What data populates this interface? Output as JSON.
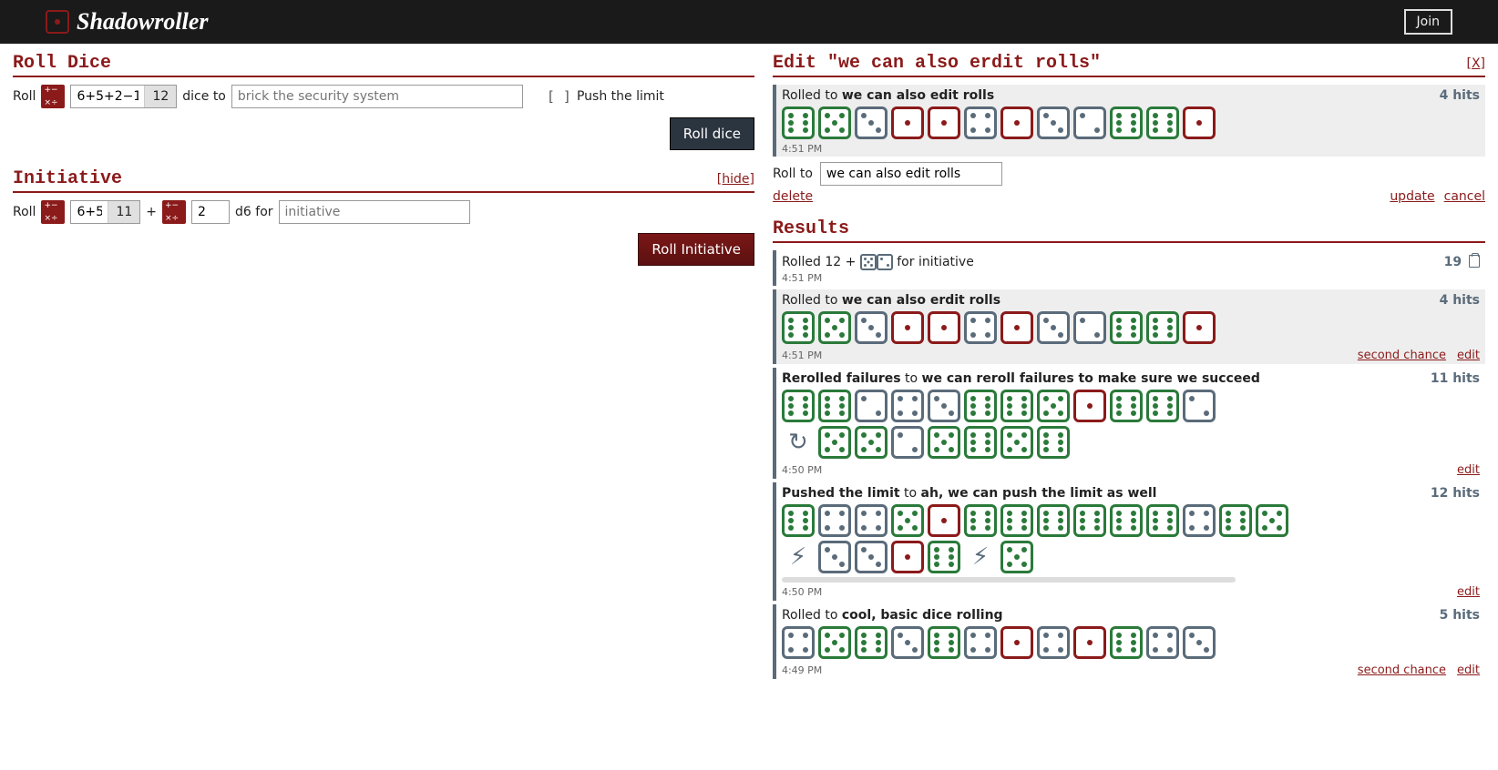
{
  "header": {
    "app_name": "Shadowroller",
    "join_label": "Join"
  },
  "roll_dice": {
    "title": "Roll Dice",
    "roll_label": "Roll",
    "expr_value": "6+5+2−1",
    "expr_result": "12",
    "dice_to_label": "dice to",
    "title_placeholder": "brick the security system",
    "push_limit_label": "Push the limit",
    "button_label": "Roll dice"
  },
  "initiative": {
    "title": "Initiative",
    "hide_label": "[hide]",
    "roll_label": "Roll",
    "base_expr": "6+5",
    "base_result": "11",
    "plus_label": "+",
    "dice_expr": "2",
    "d6_for_label": "d6 for",
    "title_placeholder": "initiative",
    "button_label": "Roll Initiative"
  },
  "edit": {
    "title": "Edit \"we can also erdit rolls\"",
    "close_label": "[X]",
    "card": {
      "prefix": "Rolled to ",
      "title": "we can also edit rolls",
      "hits": "4 hits",
      "time": "4:51 PM",
      "dice": [
        6,
        5,
        3,
        1,
        1,
        4,
        1,
        3,
        2,
        6,
        6,
        1
      ]
    },
    "roll_to_label": "Roll to",
    "roll_to_value": "we can also edit rolls",
    "delete_label": "delete",
    "update_label": "update",
    "cancel_label": "cancel"
  },
  "results": {
    "title": "Results",
    "items": [
      {
        "type": "initiative",
        "prefix": "Rolled 12 + ",
        "dice_inline": [
          5,
          2
        ],
        "suffix": " for initiative",
        "score": "19",
        "time": "4:51 PM"
      },
      {
        "type": "roll",
        "highlight": true,
        "prefix": "Rolled to ",
        "title": "we can also erdit rolls",
        "hits": "4 hits",
        "dice": [
          6,
          5,
          3,
          1,
          1,
          4,
          1,
          3,
          2,
          6,
          6,
          1
        ],
        "time": "4:51 PM",
        "actions": [
          "second chance",
          "edit"
        ]
      },
      {
        "type": "reroll",
        "prefix": "Rerolled failures",
        "mid": " to ",
        "title": "we can reroll failures to make sure we succeed",
        "hits": "11 hits",
        "dice_row1": [
          6,
          6,
          2,
          4,
          3,
          6,
          6,
          5,
          1,
          6,
          6,
          2
        ],
        "dice_row2": [
          5,
          5,
          2,
          5,
          6,
          5,
          6
        ],
        "time": "4:50 PM",
        "actions": [
          "edit"
        ]
      },
      {
        "type": "push",
        "prefix": "Pushed the limit",
        "mid": " to ",
        "title": "ah, we can push the limit as well",
        "hits": "12 hits",
        "dice_row1": [
          6,
          4,
          4,
          5,
          1,
          6,
          6,
          6,
          6,
          6,
          6,
          4,
          6,
          5
        ],
        "dice_row2": [
          "bolt",
          3,
          3,
          1,
          6,
          "bolt",
          5
        ],
        "time": "4:50 PM",
        "actions": [
          "edit"
        ],
        "scrollbar": true
      },
      {
        "type": "roll",
        "prefix": "Rolled to ",
        "title": "cool, basic dice rolling",
        "hits": "5 hits",
        "dice": [
          4,
          5,
          6,
          3,
          6,
          4,
          1,
          4,
          1,
          6,
          4,
          3
        ],
        "time": "4:49 PM",
        "actions": [
          "second chance",
          "edit"
        ]
      }
    ]
  }
}
